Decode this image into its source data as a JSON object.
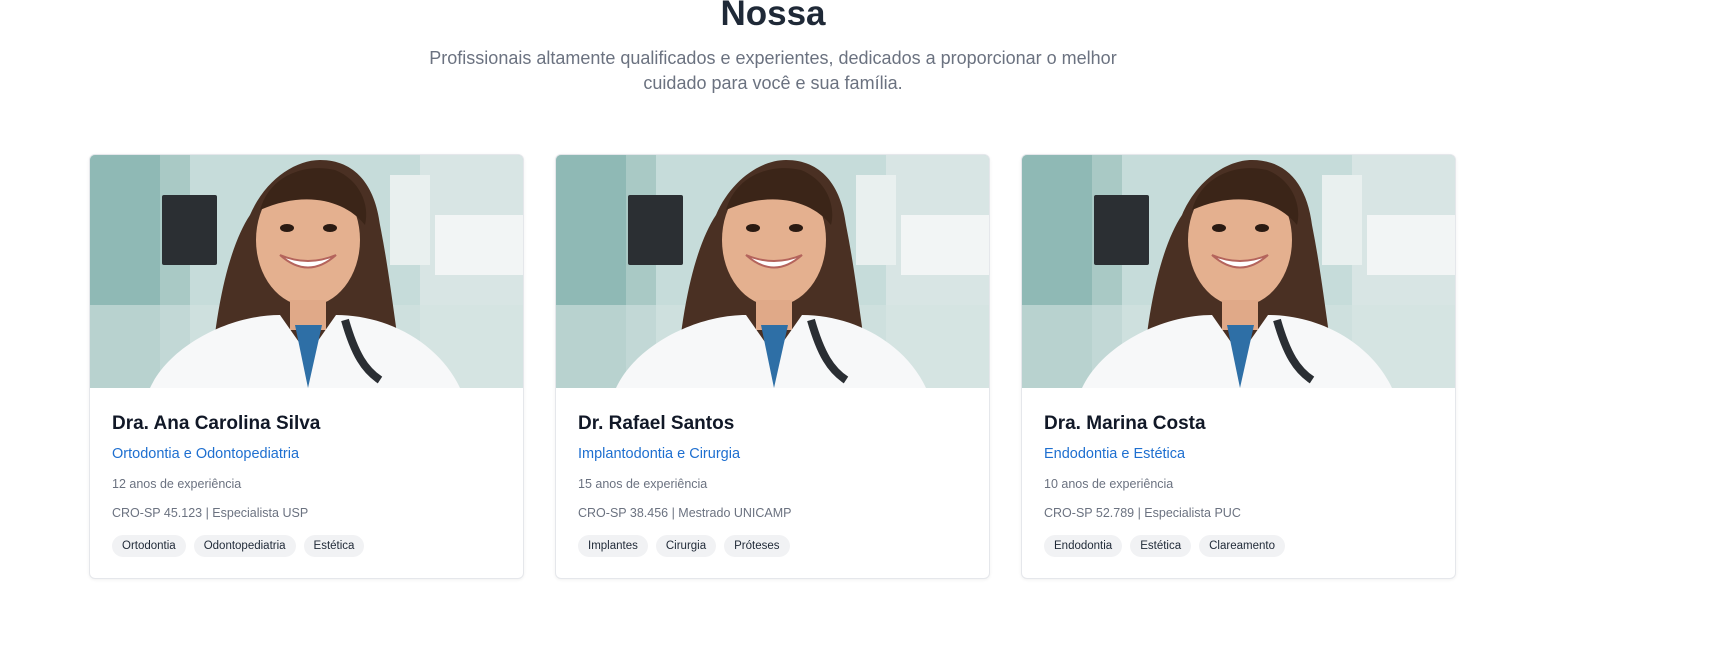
{
  "section": {
    "title": "Nossa",
    "subtitle": "Profissionais altamente qualificados e experientes, dedicados a proporcionar o melhor cuidado para você e sua família."
  },
  "team": [
    {
      "name": "Dra. Ana Carolina Silva",
      "specialty": "Ortodontia e Odontopediatria",
      "experience": "12 anos de experiência",
      "credentials": "CRO-SP 45.123 | Especialista USP",
      "tags": [
        "Ortodontia",
        "Odontopediatria",
        "Estética"
      ]
    },
    {
      "name": "Dr. Rafael Santos",
      "specialty": "Implantodontia e Cirurgia",
      "experience": "15 anos de experiência",
      "credentials": "CRO-SP 38.456 | Mestrado UNICAMP",
      "tags": [
        "Implantes",
        "Cirurgia",
        "Próteses"
      ]
    },
    {
      "name": "Dra. Marina Costa",
      "specialty": "Endodontia e Estética",
      "experience": "10 anos de experiência",
      "credentials": "CRO-SP 52.789 | Especialista PUC",
      "tags": [
        "Endodontia",
        "Estética",
        "Clareamento"
      ]
    }
  ],
  "colors": {
    "heading": "#1f2937",
    "accent": "#1e6fd0",
    "muted": "#6b7280",
    "tag_bg": "#f1f2f4"
  }
}
